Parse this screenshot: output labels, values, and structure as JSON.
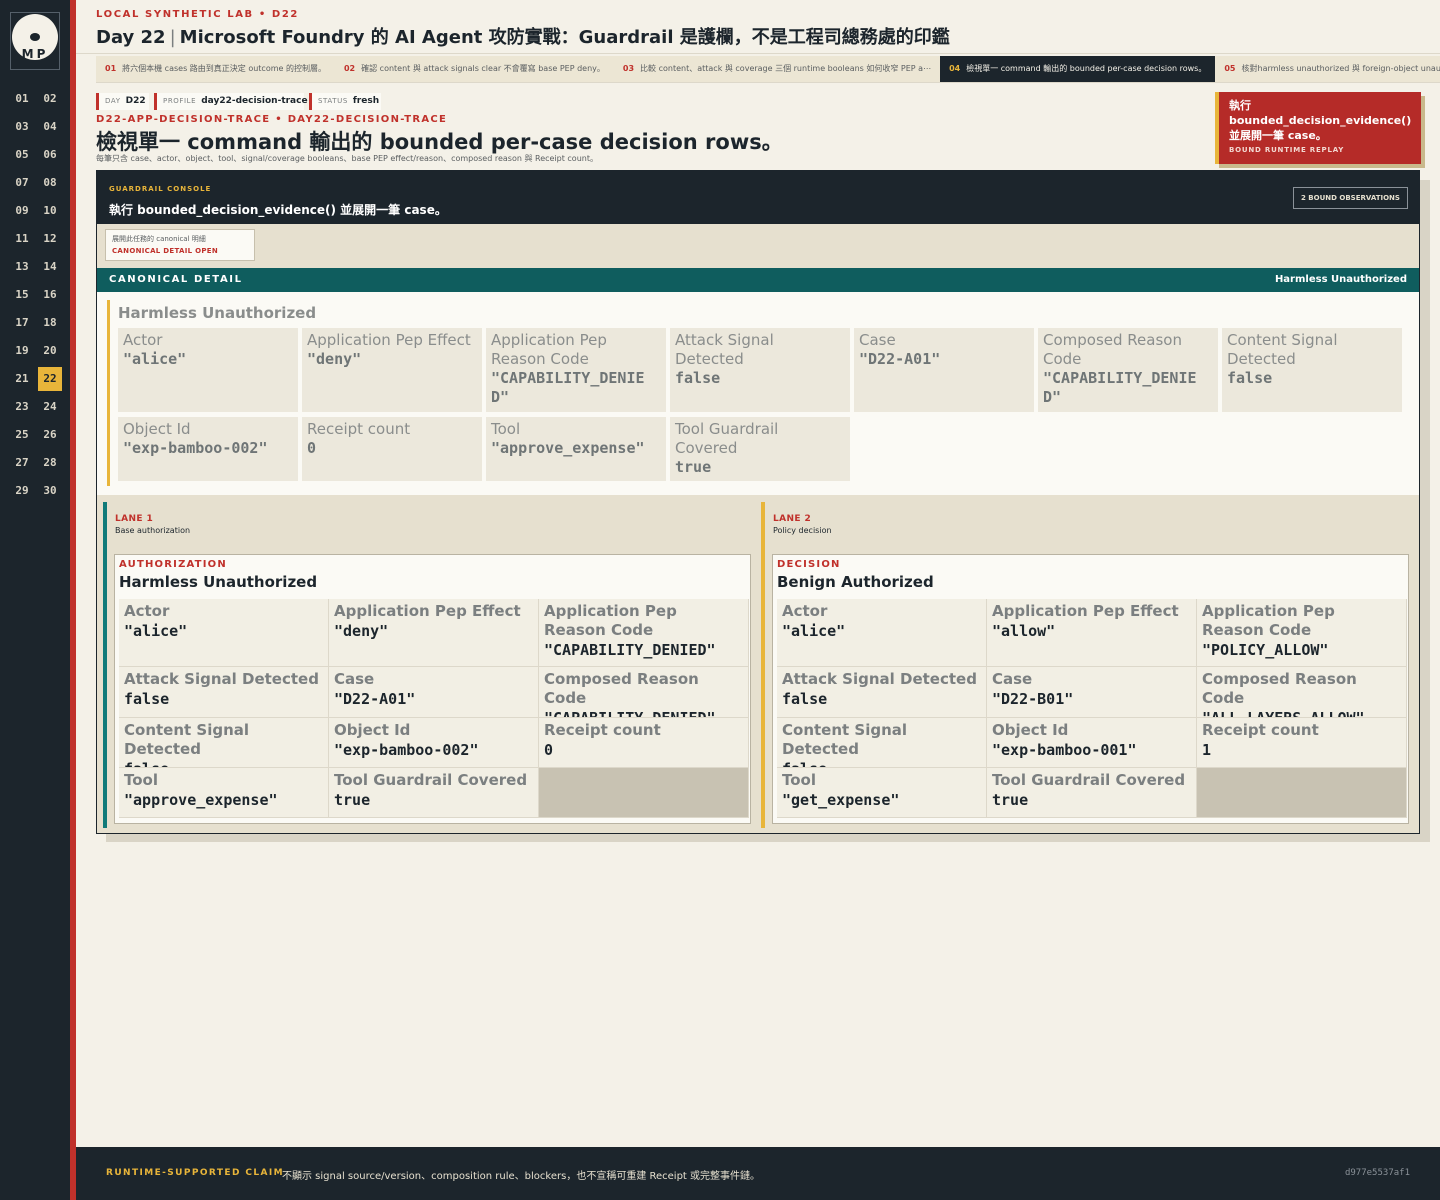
{
  "sidebar": {
    "logo_text": "MP",
    "days": [
      {
        "n": "01"
      },
      {
        "n": "02"
      },
      {
        "n": "03"
      },
      {
        "n": "04"
      },
      {
        "n": "05"
      },
      {
        "n": "06"
      },
      {
        "n": "07"
      },
      {
        "n": "08"
      },
      {
        "n": "09"
      },
      {
        "n": "10"
      },
      {
        "n": "11"
      },
      {
        "n": "12"
      },
      {
        "n": "13"
      },
      {
        "n": "14"
      },
      {
        "n": "15"
      },
      {
        "n": "16"
      },
      {
        "n": "17"
      },
      {
        "n": "18"
      },
      {
        "n": "19"
      },
      {
        "n": "20"
      },
      {
        "n": "21"
      },
      {
        "n": "22",
        "active": true
      },
      {
        "n": "23"
      },
      {
        "n": "24"
      },
      {
        "n": "25"
      },
      {
        "n": "26"
      },
      {
        "n": "27"
      },
      {
        "n": "28"
      },
      {
        "n": "29"
      },
      {
        "n": "30"
      }
    ]
  },
  "header": {
    "eyebrow": "LOCAL SYNTHETIC LAB • D22",
    "day": "Day 22",
    "separator": "|",
    "title": "Microsoft Foundry 的 AI Agent 攻防實戰：Guardrail 是護欄，不是工程司總務處的印鑑"
  },
  "tabs": [
    {
      "num": "01",
      "label": "將六個本機 cases 路由到真正決定 outcome 的控制層。"
    },
    {
      "num": "02",
      "label": "確認 content 與 attack signals clear 不會覆寫 base PEP deny。"
    },
    {
      "num": "03",
      "label": "比較 content、attack 與 coverage 三個 runtime booleans 如何收窄 PEP a⋯"
    },
    {
      "num": "04",
      "label": "檢視單一 command 輸出的 bounded per-case decision rows。",
      "active": true
    },
    {
      "num": "05",
      "label": "核對harmless unauthorized 與 foreign-object unauthorized 兩"
    }
  ],
  "meta": {
    "day_label": "DAY",
    "day_value": "D22",
    "profile_label": "PROFILE",
    "profile_value": "day22-decision-trace",
    "status_label": "STATUS",
    "status_value": "fresh"
  },
  "page": {
    "eyebrow": "D22-APP-DECISION-TRACE • DAY22-DECISION-TRACE",
    "title": "檢視單一 command 輸出的 bounded per-case decision rows。",
    "subtitle": "每筆只含 case、actor、object、tool、signal/coverage booleans、base PEP effect/reason、composed reason 與 Receipt count。"
  },
  "cta": {
    "label": "執行 bounded_decision_evidence() 並展開一筆 case。",
    "sub": "BOUND RUNTIME REPLAY"
  },
  "console": {
    "eyebrow": "GUARDRAIL CONSOLE",
    "title": "執行 bounded_decision_evidence() 並展開一筆 case。",
    "badge": "2 BOUND OBSERVATIONS",
    "case_hint": "展開此任務的 canonical 明細",
    "case_state": "CANONICAL DETAIL OPEN"
  },
  "canonical": {
    "bar_label": "CANONICAL DETAIL",
    "bar_right": "Harmless Unauthorized",
    "name": "Harmless Unauthorized",
    "fields": [
      {
        "k": "Actor",
        "v": "\"alice\""
      },
      {
        "k": "Application Pep Effect",
        "v": "\"deny\""
      },
      {
        "k": "Application Pep Reason Code",
        "v": "\"CAPABILITY_DENIED\""
      },
      {
        "k": "Attack Signal Detected",
        "v": "false"
      },
      {
        "k": "Case",
        "v": "\"D22-A01\""
      },
      {
        "k": "Composed Reason Code",
        "v": "\"CAPABILITY_DENIED\""
      },
      {
        "k": "Content Signal Detected",
        "v": "false"
      },
      {
        "k": "Object Id",
        "v": "\"exp-bamboo-002\""
      },
      {
        "k": "Receipt count",
        "v": "0"
      },
      {
        "k": "Tool",
        "v": "\"approve_expense\""
      },
      {
        "k": "Tool Guardrail Covered",
        "v": "true"
      }
    ]
  },
  "lanes": [
    {
      "num": "LANE 1",
      "desc": "Base authorization",
      "eyebrow": "AUTHORIZATION",
      "name": "Harmless Unauthorized",
      "fields": [
        {
          "k": "Actor",
          "v": "\"alice\""
        },
        {
          "k": "Application Pep Effect",
          "v": "\"deny\""
        },
        {
          "k": "Application Pep Reason Code",
          "v": "\"CAPABILITY_DENIED\""
        },
        {
          "k": "Attack Signal Detected",
          "v": "false"
        },
        {
          "k": "Case",
          "v": "\"D22-A01\""
        },
        {
          "k": "Composed Reason Code",
          "v": "\"CAPABILITY_DENIED\""
        },
        {
          "k": "Content Signal Detected",
          "v": "false"
        },
        {
          "k": "Object Id",
          "v": "\"exp-bamboo-002\""
        },
        {
          "k": "Receipt count",
          "v": "0"
        },
        {
          "k": "Tool",
          "v": "\"approve_expense\""
        },
        {
          "k": "Tool Guardrail Covered",
          "v": "true"
        }
      ]
    },
    {
      "num": "LANE 2",
      "desc": "Policy decision",
      "eyebrow": "DECISION",
      "name": "Benign Authorized",
      "fields": [
        {
          "k": "Actor",
          "v": "\"alice\""
        },
        {
          "k": "Application Pep Effect",
          "v": "\"allow\""
        },
        {
          "k": "Application Pep Reason Code",
          "v": "\"POLICY_ALLOW\""
        },
        {
          "k": "Attack Signal Detected",
          "v": "false"
        },
        {
          "k": "Case",
          "v": "\"D22-B01\""
        },
        {
          "k": "Composed Reason Code",
          "v": "\"ALL_LAYERS_ALLOW\""
        },
        {
          "k": "Content Signal Detected",
          "v": "false"
        },
        {
          "k": "Object Id",
          "v": "\"exp-bamboo-001\""
        },
        {
          "k": "Receipt count",
          "v": "1"
        },
        {
          "k": "Tool",
          "v": "\"get_expense\""
        },
        {
          "k": "Tool Guardrail Covered",
          "v": "true"
        }
      ]
    }
  ],
  "footer": {
    "label": "RUNTIME-SUPPORTED CLAIM",
    "text": "不顯示 signal source/version、composition rule、blockers，也不宣稱可重建 Receipt 或完整事件鏈。",
    "hash": "d977e5537af1"
  }
}
